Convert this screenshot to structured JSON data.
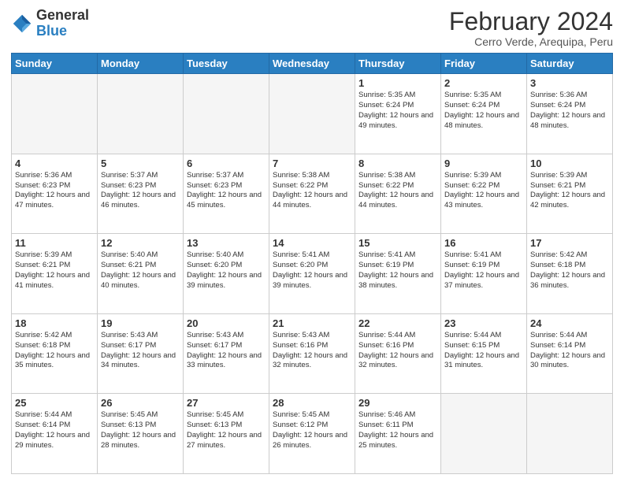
{
  "header": {
    "logo_general": "General",
    "logo_blue": "Blue",
    "month_title": "February 2024",
    "subtitle": "Cerro Verde, Arequipa, Peru"
  },
  "days_of_week": [
    "Sunday",
    "Monday",
    "Tuesday",
    "Wednesday",
    "Thursday",
    "Friday",
    "Saturday"
  ],
  "weeks": [
    [
      {
        "day": "",
        "info": "",
        "empty": true
      },
      {
        "day": "",
        "info": "",
        "empty": true
      },
      {
        "day": "",
        "info": "",
        "empty": true
      },
      {
        "day": "",
        "info": "",
        "empty": true
      },
      {
        "day": "1",
        "info": "Sunrise: 5:35 AM\nSunset: 6:24 PM\nDaylight: 12 hours\nand 49 minutes."
      },
      {
        "day": "2",
        "info": "Sunrise: 5:35 AM\nSunset: 6:24 PM\nDaylight: 12 hours\nand 48 minutes."
      },
      {
        "day": "3",
        "info": "Sunrise: 5:36 AM\nSunset: 6:24 PM\nDaylight: 12 hours\nand 48 minutes."
      }
    ],
    [
      {
        "day": "4",
        "info": "Sunrise: 5:36 AM\nSunset: 6:23 PM\nDaylight: 12 hours\nand 47 minutes."
      },
      {
        "day": "5",
        "info": "Sunrise: 5:37 AM\nSunset: 6:23 PM\nDaylight: 12 hours\nand 46 minutes."
      },
      {
        "day": "6",
        "info": "Sunrise: 5:37 AM\nSunset: 6:23 PM\nDaylight: 12 hours\nand 45 minutes."
      },
      {
        "day": "7",
        "info": "Sunrise: 5:38 AM\nSunset: 6:22 PM\nDaylight: 12 hours\nand 44 minutes."
      },
      {
        "day": "8",
        "info": "Sunrise: 5:38 AM\nSunset: 6:22 PM\nDaylight: 12 hours\nand 44 minutes."
      },
      {
        "day": "9",
        "info": "Sunrise: 5:39 AM\nSunset: 6:22 PM\nDaylight: 12 hours\nand 43 minutes."
      },
      {
        "day": "10",
        "info": "Sunrise: 5:39 AM\nSunset: 6:21 PM\nDaylight: 12 hours\nand 42 minutes."
      }
    ],
    [
      {
        "day": "11",
        "info": "Sunrise: 5:39 AM\nSunset: 6:21 PM\nDaylight: 12 hours\nand 41 minutes."
      },
      {
        "day": "12",
        "info": "Sunrise: 5:40 AM\nSunset: 6:21 PM\nDaylight: 12 hours\nand 40 minutes."
      },
      {
        "day": "13",
        "info": "Sunrise: 5:40 AM\nSunset: 6:20 PM\nDaylight: 12 hours\nand 39 minutes."
      },
      {
        "day": "14",
        "info": "Sunrise: 5:41 AM\nSunset: 6:20 PM\nDaylight: 12 hours\nand 39 minutes."
      },
      {
        "day": "15",
        "info": "Sunrise: 5:41 AM\nSunset: 6:19 PM\nDaylight: 12 hours\nand 38 minutes."
      },
      {
        "day": "16",
        "info": "Sunrise: 5:41 AM\nSunset: 6:19 PM\nDaylight: 12 hours\nand 37 minutes."
      },
      {
        "day": "17",
        "info": "Sunrise: 5:42 AM\nSunset: 6:18 PM\nDaylight: 12 hours\nand 36 minutes."
      }
    ],
    [
      {
        "day": "18",
        "info": "Sunrise: 5:42 AM\nSunset: 6:18 PM\nDaylight: 12 hours\nand 35 minutes."
      },
      {
        "day": "19",
        "info": "Sunrise: 5:43 AM\nSunset: 6:17 PM\nDaylight: 12 hours\nand 34 minutes."
      },
      {
        "day": "20",
        "info": "Sunrise: 5:43 AM\nSunset: 6:17 PM\nDaylight: 12 hours\nand 33 minutes."
      },
      {
        "day": "21",
        "info": "Sunrise: 5:43 AM\nSunset: 6:16 PM\nDaylight: 12 hours\nand 32 minutes."
      },
      {
        "day": "22",
        "info": "Sunrise: 5:44 AM\nSunset: 6:16 PM\nDaylight: 12 hours\nand 32 minutes."
      },
      {
        "day": "23",
        "info": "Sunrise: 5:44 AM\nSunset: 6:15 PM\nDaylight: 12 hours\nand 31 minutes."
      },
      {
        "day": "24",
        "info": "Sunrise: 5:44 AM\nSunset: 6:14 PM\nDaylight: 12 hours\nand 30 minutes."
      }
    ],
    [
      {
        "day": "25",
        "info": "Sunrise: 5:44 AM\nSunset: 6:14 PM\nDaylight: 12 hours\nand 29 minutes."
      },
      {
        "day": "26",
        "info": "Sunrise: 5:45 AM\nSunset: 6:13 PM\nDaylight: 12 hours\nand 28 minutes."
      },
      {
        "day": "27",
        "info": "Sunrise: 5:45 AM\nSunset: 6:13 PM\nDaylight: 12 hours\nand 27 minutes."
      },
      {
        "day": "28",
        "info": "Sunrise: 5:45 AM\nSunset: 6:12 PM\nDaylight: 12 hours\nand 26 minutes."
      },
      {
        "day": "29",
        "info": "Sunrise: 5:46 AM\nSunset: 6:11 PM\nDaylight: 12 hours\nand 25 minutes."
      },
      {
        "day": "",
        "info": "",
        "empty": true
      },
      {
        "day": "",
        "info": "",
        "empty": true
      }
    ]
  ]
}
